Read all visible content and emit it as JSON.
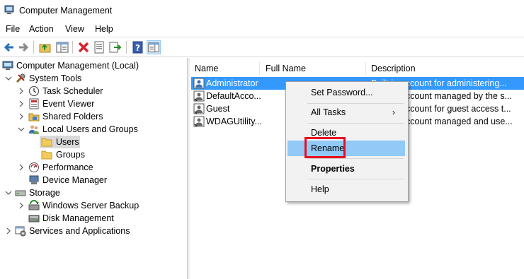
{
  "window": {
    "title": "Computer Management",
    "app_icon": "computer-management-icon"
  },
  "menubar": {
    "items": [
      "File",
      "Action",
      "View",
      "Help"
    ]
  },
  "toolbar": {
    "buttons": [
      "back-icon",
      "forward-icon",
      "up-folder-icon",
      "show-hide-tree-icon",
      "delete-icon",
      "properties-icon",
      "export-icon",
      "help-icon",
      "show-action-pane-icon"
    ]
  },
  "tree": {
    "items": [
      {
        "label": "Computer Management (Local)",
        "icon": "computer-management-icon"
      },
      {
        "label": "System Tools",
        "icon": "tools-icon"
      },
      {
        "label": "Task Scheduler",
        "icon": "clock-icon"
      },
      {
        "label": "Event Viewer",
        "icon": "event-viewer-icon"
      },
      {
        "label": "Shared Folders",
        "icon": "shared-folders-icon"
      },
      {
        "label": "Local Users and Groups",
        "icon": "users-groups-icon"
      },
      {
        "label": "Users",
        "icon": "folder-icon"
      },
      {
        "label": "Groups",
        "icon": "folder-icon"
      },
      {
        "label": "Performance",
        "icon": "performance-icon"
      },
      {
        "label": "Device Manager",
        "icon": "device-manager-icon"
      },
      {
        "label": "Storage",
        "icon": "storage-icon"
      },
      {
        "label": "Windows Server Backup",
        "icon": "backup-icon"
      },
      {
        "label": "Disk Management",
        "icon": "disk-icon"
      },
      {
        "label": "Services and Applications",
        "icon": "services-icon"
      }
    ]
  },
  "list": {
    "columns": [
      "Name",
      "Full Name",
      "Description"
    ],
    "rows": [
      {
        "name": "Administrator",
        "full_name": "",
        "description": "Built-in account for administering..."
      },
      {
        "name": "DefaultAcco...",
        "full_name": "",
        "description": "account managed by the s..."
      },
      {
        "name": "Guest",
        "full_name": "",
        "description": "account for guest access t..."
      },
      {
        "name": "WDAGUtility...",
        "full_name": "",
        "description": "account managed and use..."
      }
    ]
  },
  "context_menu": {
    "items": [
      "Set Password...",
      "All Tasks",
      "Delete",
      "Rename",
      "Properties",
      "Help"
    ],
    "submenu_arrow": "›"
  },
  "colors": {
    "selection": "#3399ff",
    "menu_hover": "#91c9f7",
    "highlight_border": "#e8101f"
  }
}
